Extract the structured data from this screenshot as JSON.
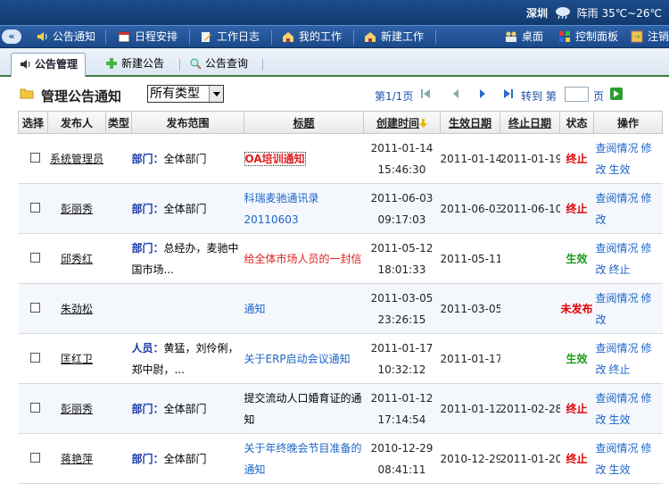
{
  "topbar": {
    "city": "深圳",
    "weather": "阵雨 35℃~26℃"
  },
  "menubar": {
    "collapse_glyph": "«",
    "items": [
      {
        "label": "公告通知",
        "icon": "speaker-icon"
      },
      {
        "label": "日程安排",
        "icon": "calendar-icon"
      },
      {
        "label": "工作日志",
        "icon": "pencil-icon"
      },
      {
        "label": "我的工作",
        "icon": "home-icon"
      },
      {
        "label": "新建工作",
        "icon": "home-plus-icon"
      }
    ],
    "right_items": [
      {
        "label": "桌面",
        "icon": "people-icon"
      },
      {
        "label": "控制面板",
        "icon": "panel-icon"
      },
      {
        "label": "注销",
        "icon": "logout-icon"
      }
    ]
  },
  "tabs": [
    {
      "label": "公告管理",
      "active": true
    },
    {
      "label": "新建公告",
      "active": false
    },
    {
      "label": "公告查询",
      "active": false
    }
  ],
  "toolbar": {
    "title": "管理公告通知",
    "type_select": "所有类型",
    "pager": "第1/1页",
    "goto_label": "转到 第",
    "page_input": "",
    "page_unit": "页"
  },
  "table": {
    "headers": [
      "选择",
      "发布人",
      "类型",
      "发布范围",
      "标题",
      "创建时间",
      "生效日期",
      "终止日期",
      "状态",
      "操作"
    ],
    "rows": [
      {
        "publisher": "系统管理员",
        "scope_label": "部门：",
        "scope_value": "全体部门",
        "title": "OA培训通知",
        "title_style": "boxed",
        "created_date": "2011-01-14",
        "created_time": "15:46:30",
        "effective": "2011-01-14",
        "end": "2011-01-19",
        "status": "终止",
        "status_cls": "st-stop",
        "ops": [
          "查阅情况",
          "修改",
          "生效"
        ]
      },
      {
        "publisher": "彭丽秀",
        "scope_label": "部门：",
        "scope_value": "全体部门",
        "title": "科瑞麦驰通讯录20110603",
        "title_style": "link",
        "created_date": "2011-06-03",
        "created_time": "09:17:03",
        "effective": "2011-06-03",
        "end": "2011-06-10",
        "status": "终止",
        "status_cls": "st-stop",
        "ops": [
          "查阅情况",
          "修改"
        ]
      },
      {
        "publisher": "邱秀红",
        "scope_label": "部门：",
        "scope_value": "总经办，麦驰中国市场...",
        "title": "给全体市场人员的一封信",
        "title_style": "red",
        "created_date": "2011-05-12",
        "created_time": "18:01:33",
        "effective": "2011-05-11",
        "end": "",
        "status": "生效",
        "status_cls": "st-on",
        "ops": [
          "查阅情况",
          "修改",
          "终止"
        ]
      },
      {
        "publisher": "朱劲松",
        "scope_label": "",
        "scope_value": "",
        "title": "通知",
        "title_style": "link",
        "created_date": "2011-03-05",
        "created_time": "23:26:15",
        "effective": "2011-03-05",
        "end": "",
        "status": "未发布",
        "status_cls": "st-unpub",
        "ops": [
          "查阅情况",
          "修改"
        ]
      },
      {
        "publisher": "匡红卫",
        "scope_label": "人员：",
        "scope_value": "黄猛，刘伶俐，郑中尉，...",
        "title": "关于ERP启动会议通知",
        "title_style": "link",
        "created_date": "2011-01-17",
        "created_time": "10:32:12",
        "effective": "2011-01-17",
        "end": "",
        "status": "生效",
        "status_cls": "st-on",
        "ops": [
          "查阅情况",
          "修改",
          "终止"
        ]
      },
      {
        "publisher": "彭丽秀",
        "scope_label": "部门：",
        "scope_value": "全体部门",
        "title": "提交流动人口婚育证的通知",
        "title_style": "plain",
        "created_date": "2011-01-12",
        "created_time": "17:14:54",
        "effective": "2011-01-12",
        "end": "2011-02-28",
        "status": "终止",
        "status_cls": "st-stop",
        "ops": [
          "查阅情况",
          "修改",
          "生效"
        ]
      },
      {
        "publisher": "蒋艳萍",
        "scope_label": "部门：",
        "scope_value": "全体部门",
        "title": "关于年终晚会节目准备的通知",
        "title_style": "link",
        "created_date": "2010-12-29",
        "created_time": "08:41:11",
        "effective": "2010-12-29",
        "end": "2011-01-20",
        "status": "终止",
        "status_cls": "st-stop",
        "ops": [
          "查阅情况",
          "修改",
          "生效"
        ]
      }
    ]
  }
}
